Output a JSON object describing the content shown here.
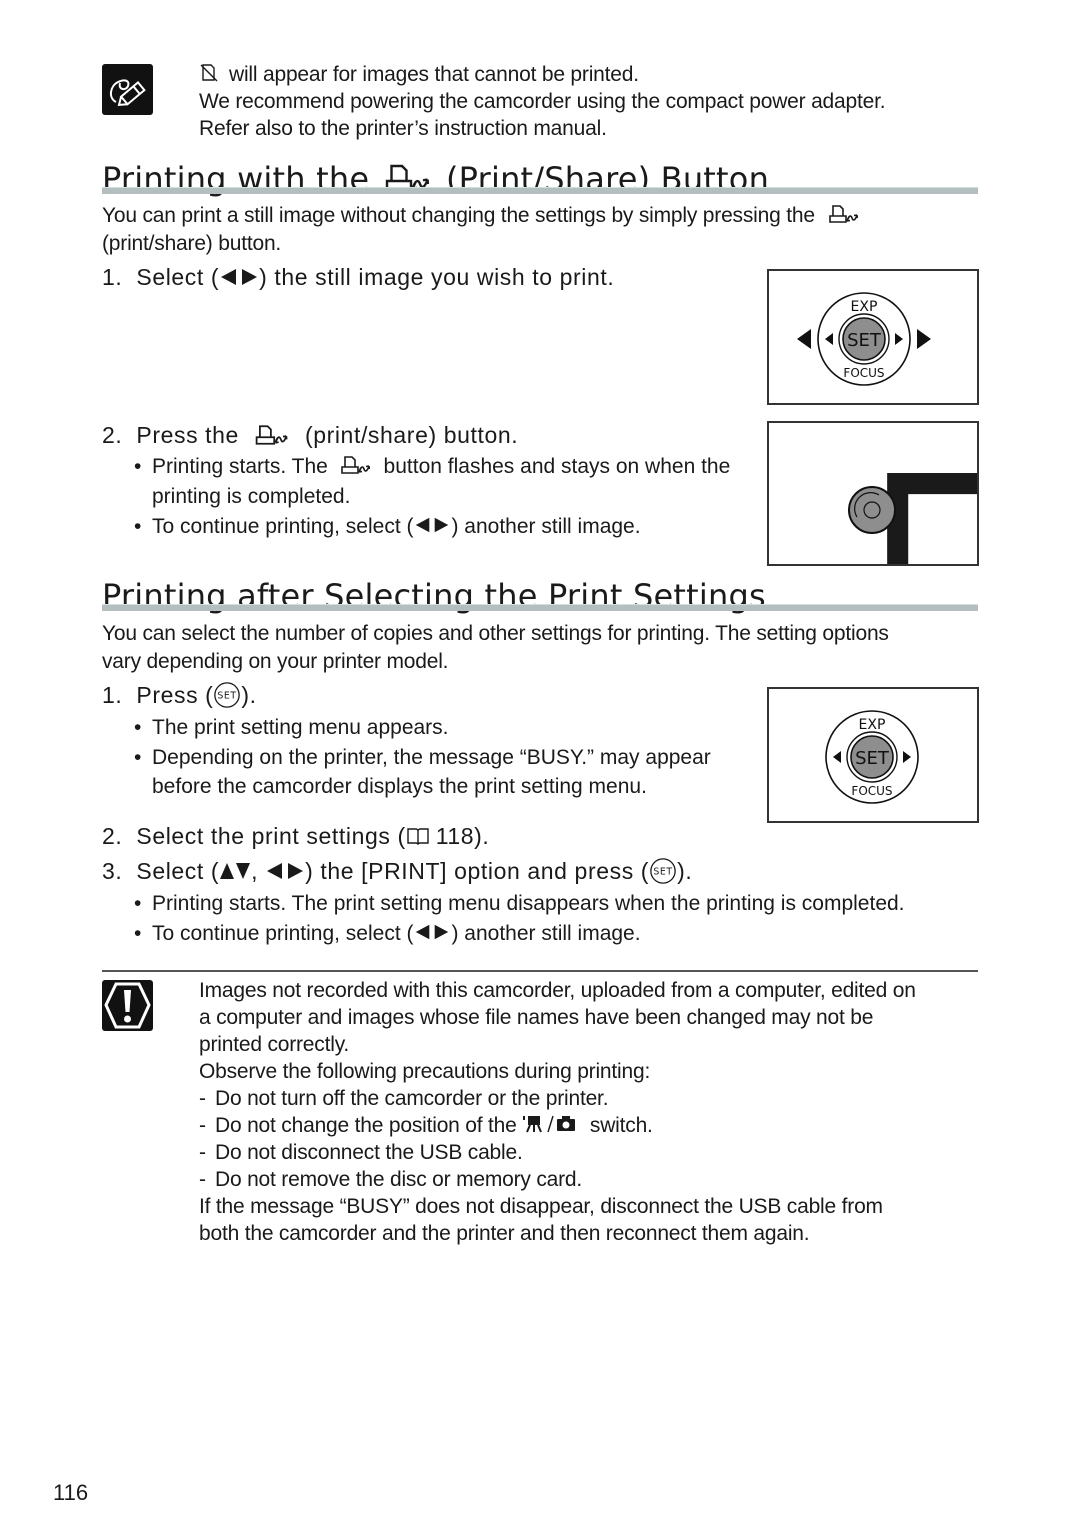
{
  "note": {
    "icon": "pencil-note-icon",
    "line1_suffix": "will appear for images that cannot be printed.",
    "line1_icon": "no-print-icon",
    "line2": "We recommend powering the camcorder using the compact power adapter.",
    "line3": "Refer also to the printer’s instruction manual."
  },
  "section1": {
    "title_prefix": "Printing with the",
    "title_icon": "print-share-icon",
    "title_suffix": "(Print/Share) Button",
    "intro_part1": "You can print a still image without changing the settings by simply pressing the",
    "intro_part2": "(print/share) button.",
    "step1": {
      "num": "1.",
      "prefix": "Select (",
      "suffix": ") the still image you wish to print."
    },
    "step2": {
      "num": "2.",
      "prefix": "Press the",
      "suffix": "(print/share) button."
    },
    "bullets": [
      {
        "prefix": "Printing starts. The",
        "suffix": "button flashes and stays on when the",
        "cont": "printing is completed."
      },
      {
        "prefix": "To continue printing, select (",
        "suffix": ") another still image."
      }
    ],
    "fig1": {
      "top_label": "EXP",
      "center_label": "SET",
      "bottom_label": "FOCUS"
    },
    "fig2": {
      "icon": "print-share-icon"
    }
  },
  "section2": {
    "title": "Printing after Selecting the Print Settings",
    "intro_line1": "You can select the number of copies and other settings for printing. The setting options",
    "intro_line2": "vary depending on your printer model.",
    "step1": {
      "num": "1.",
      "prefix": "Press (",
      "suffix": ")."
    },
    "step1_bullets": [
      {
        "text": "The print setting menu appears."
      },
      {
        "text": "Depending on the printer, the message “BUSY.” may appear",
        "cont": "before the camcorder displays the print setting menu."
      }
    ],
    "step2": {
      "num": "2.",
      "prefix": "Select the print settings (",
      "page_ref": "118",
      "suffix": ")."
    },
    "step3": {
      "num": "3.",
      "prefix": "Select (",
      "mid": ",",
      "middle_text": ") the [PRINT] option and press (",
      "suffix": ")."
    },
    "step3_bullets": [
      {
        "text": "Printing starts. The print setting menu disappears when the printing is completed."
      },
      {
        "prefix": "To continue printing, select (",
        "suffix": ") another still image."
      }
    ],
    "fig3": {
      "top_label": "EXP",
      "center_label": "SET",
      "bottom_label": "FOCUS"
    },
    "set_button_label": "SET"
  },
  "caution": {
    "icon": "caution-icon",
    "para1_lines": [
      "Images not recorded with this camcorder, uploaded from a computer, edited on",
      "a computer and images whose file names have been changed may not be",
      "printed correctly."
    ],
    "para2": "Observe the following precautions during printing:",
    "items": [
      {
        "text": "Do not turn off the camcorder or the printer."
      },
      {
        "prefix": "Do not change the position of the",
        "suffix": "switch."
      },
      {
        "text": "Do not disconnect the USB cable."
      },
      {
        "text": "Do not remove the disc or memory card."
      }
    ],
    "para3_lines": [
      "If the message “BUSY” does not disappear, disconnect the USB cable from",
      "both the camcorder and the printer and then reconnect them again."
    ]
  },
  "page_number": "116"
}
